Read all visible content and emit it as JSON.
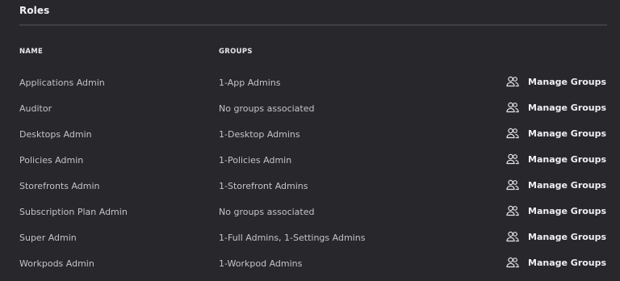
{
  "section": {
    "title": "Roles"
  },
  "table": {
    "headers": {
      "name": "NAME",
      "groups": "GROUPS"
    },
    "action_label": "Manage Groups",
    "action_icon": "users-icon",
    "rows": [
      {
        "name": "Applications Admin",
        "groups": "1-App Admins"
      },
      {
        "name": "Auditor",
        "groups": "No groups associated"
      },
      {
        "name": "Desktops Admin",
        "groups": "1-Desktop Admins"
      },
      {
        "name": "Policies Admin",
        "groups": "1-Policies Admin"
      },
      {
        "name": "Storefronts Admin",
        "groups": "1-Storefront Admins"
      },
      {
        "name": "Subscription Plan Admin",
        "groups": "No groups associated"
      },
      {
        "name": "Super Admin",
        "groups": "1-Full Admins, 1-Settings Admins"
      },
      {
        "name": "Workpods Admin",
        "groups": "1-Workpod Admins"
      }
    ]
  },
  "colors": {
    "background": "#28282c",
    "divider": "#3e3e43",
    "text": "#c4c4c8",
    "heading": "#f2f2f4"
  }
}
